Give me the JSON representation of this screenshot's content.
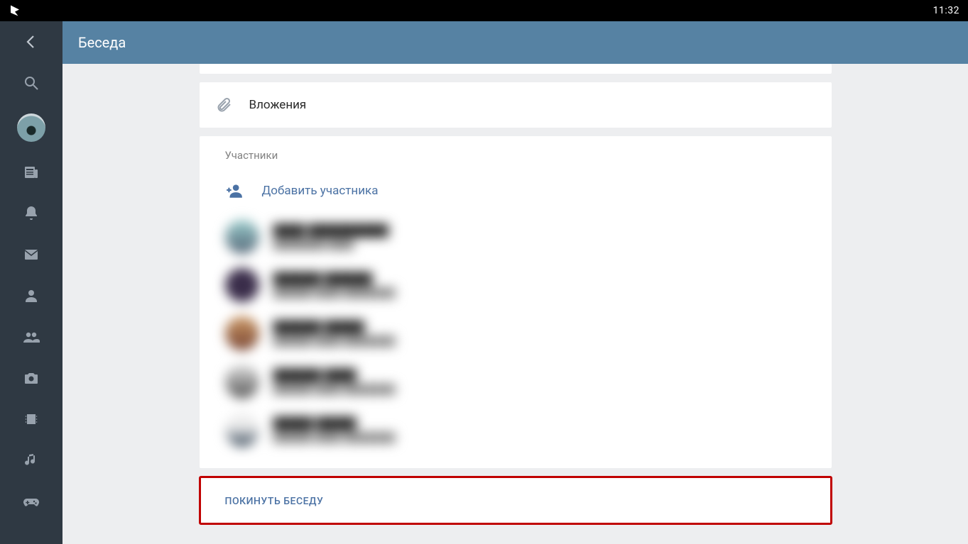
{
  "statusbar": {
    "time": "11:32"
  },
  "header": {
    "title": "Беседа"
  },
  "attachments": {
    "label": "Вложения"
  },
  "participants": {
    "section_title": "Участники",
    "add_label": "Добавить участника",
    "list": [
      {
        "name": "████ ██████████",
        "sub": "████████ ████"
      },
      {
        "name": "██████ ██████",
        "sub": "██████ ████ ████████"
      },
      {
        "name": "██████ █████",
        "sub": "██████ ████ ████████"
      },
      {
        "name": "██████ ████",
        "sub": "██████ ████ ████████"
      },
      {
        "name": "█████ █████",
        "sub": "██████ ████ ████████"
      }
    ]
  },
  "leave": {
    "label": "ПОКИНУТЬ БЕСЕДУ"
  },
  "sidebar": {
    "items": [
      "back",
      "search",
      "profile",
      "news",
      "notifications",
      "messages",
      "friends",
      "groups",
      "photos",
      "videos",
      "music",
      "games"
    ]
  }
}
